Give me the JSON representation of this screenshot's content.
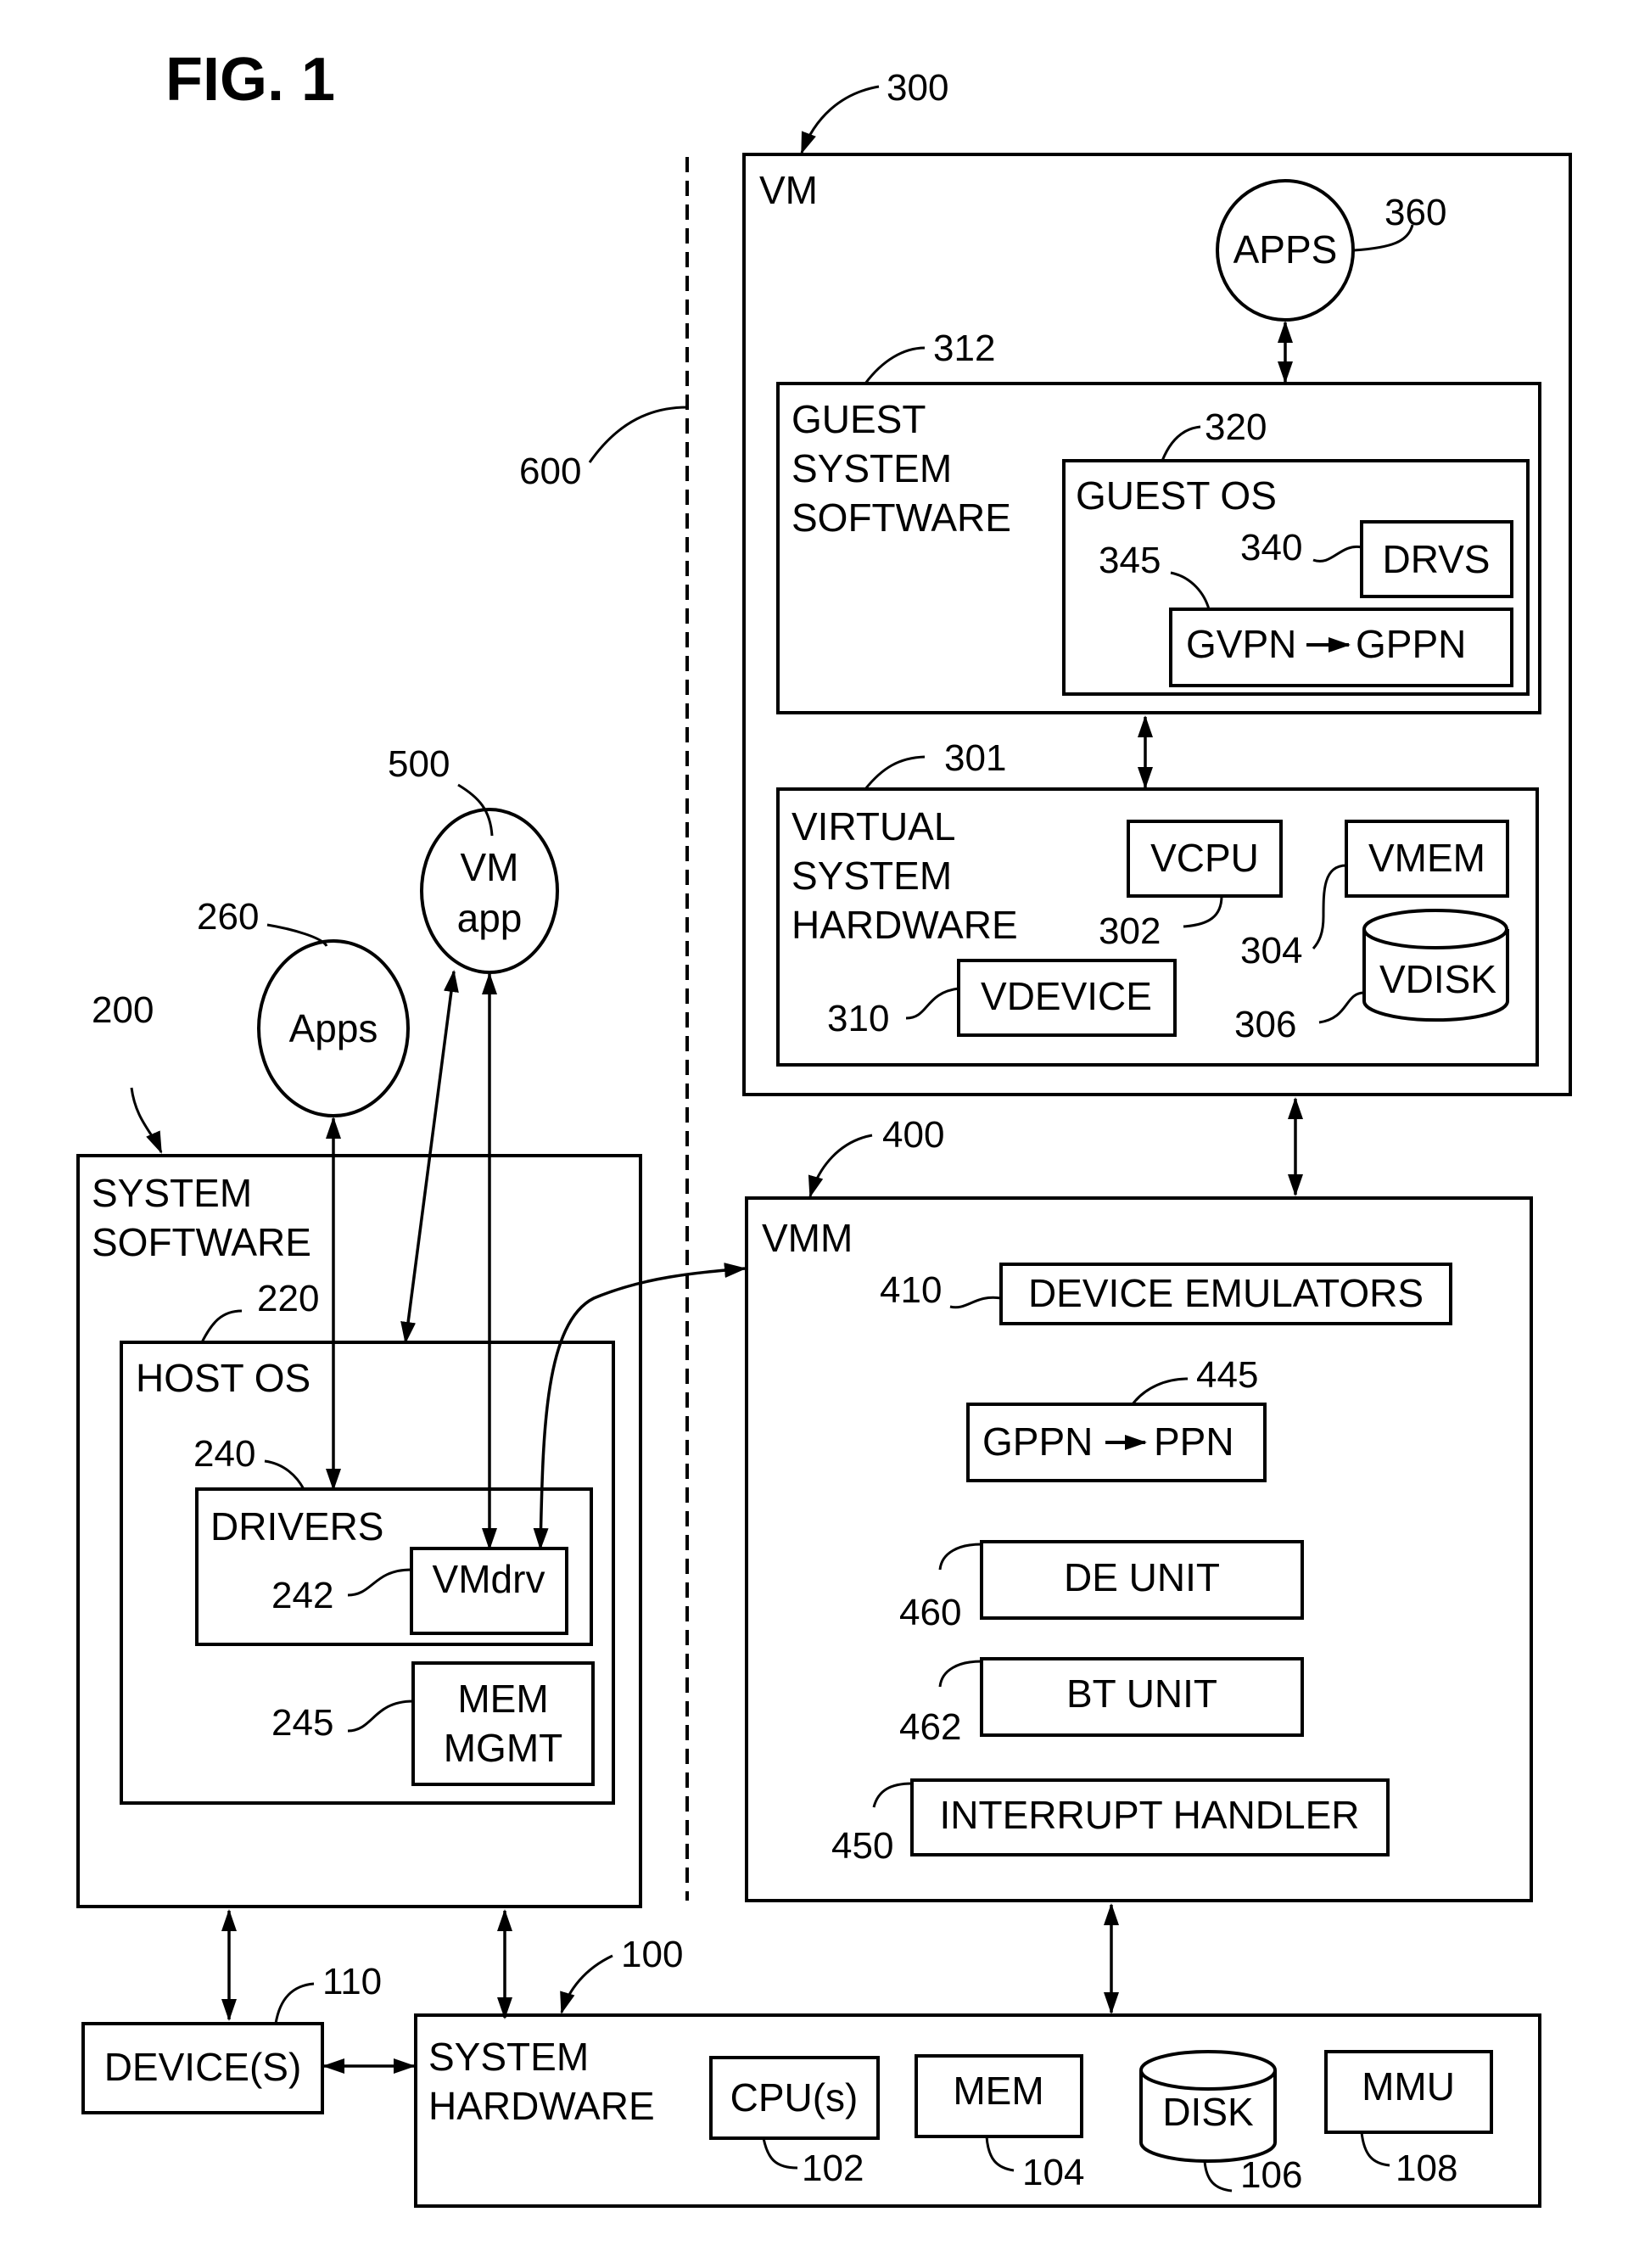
{
  "figure_title": "FIG. 1",
  "boundary_ref": "600",
  "vm": {
    "ref": "300",
    "label": "VM",
    "apps": {
      "label": "APPS",
      "ref": "360"
    },
    "guest_system_software": {
      "ref": "312",
      "label_lines": [
        "GUEST",
        "SYSTEM",
        "SOFTWARE"
      ],
      "guest_os": {
        "ref": "320",
        "label": "GUEST OS",
        "drvs": {
          "label": "DRVS",
          "ref": "340"
        },
        "mapping": {
          "label_from": "GVPN",
          "label_to": "GPPN",
          "ref": "345"
        }
      }
    },
    "virtual_system_hardware": {
      "ref": "301",
      "label_lines": [
        "VIRTUAL",
        "SYSTEM",
        "HARDWARE"
      ],
      "vcpu": {
        "label": "VCPU",
        "ref": "302"
      },
      "vmem": {
        "label": "VMEM",
        "ref": "304"
      },
      "vdisk": {
        "label": "VDISK",
        "ref": "306"
      },
      "vdevice": {
        "label": "VDEVICE",
        "ref": "310"
      }
    }
  },
  "vmm": {
    "ref": "400",
    "label": "VMM",
    "device_emulators": {
      "label": "DEVICE EMULATORS",
      "ref": "410"
    },
    "mapping": {
      "label_from": "GPPN",
      "label_to": "PPN",
      "ref": "445"
    },
    "de_unit": {
      "label": "DE UNIT",
      "ref": "460"
    },
    "bt_unit": {
      "label": "BT UNIT",
      "ref": "462"
    },
    "interrupt_handler": {
      "label": "INTERRUPT HANDLER",
      "ref": "450"
    }
  },
  "host": {
    "vm_app": {
      "label_lines": [
        "VM",
        "app"
      ],
      "ref": "500"
    },
    "apps": {
      "label": "Apps",
      "ref": "260"
    },
    "system_software": {
      "ref": "200",
      "label_lines": [
        "SYSTEM",
        "SOFTWARE"
      ],
      "host_os": {
        "ref": "220",
        "label": "HOST OS",
        "drivers": {
          "label": "DRIVERS",
          "ref": "240",
          "vmdrv": {
            "label": "VMdrv",
            "ref": "242"
          }
        },
        "mem_mgmt": {
          "label_lines": [
            "MEM",
            "MGMT"
          ],
          "ref": "245"
        }
      }
    }
  },
  "devices": {
    "label": "DEVICE(S)",
    "ref": "110"
  },
  "system_hardware": {
    "ref": "100",
    "label_lines": [
      "SYSTEM",
      "HARDWARE"
    ],
    "cpus": {
      "label": "CPU(s)",
      "ref": "102"
    },
    "mem": {
      "label": "MEM",
      "ref": "104"
    },
    "disk": {
      "label": "DISK",
      "ref": "106"
    },
    "mmu": {
      "label": "MMU",
      "ref": "108"
    }
  }
}
